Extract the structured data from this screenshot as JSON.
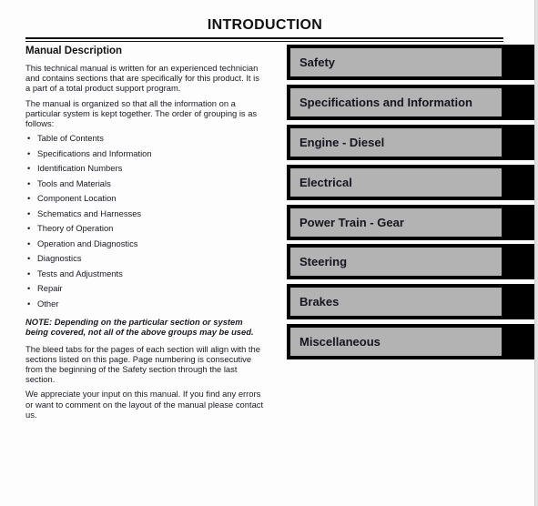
{
  "page": {
    "title": "INTRODUCTION"
  },
  "manual_description": {
    "heading": "Manual Description",
    "intro": "This technical manual is written for an experienced technician and contains sections that are specifically for this product. It is a part of a total product support program.",
    "organization": "The manual is organized so that all the information on a particular system is kept together. The order of grouping is as follows:",
    "groups": [
      "Table of Contents",
      "Specifications and Information",
      "Identification Numbers",
      "Tools and Materials",
      "Component Location",
      "Schematics and Harnesses",
      "Theory of Operation",
      "Operation and Diagnostics",
      "Diagnostics",
      "Tests and Adjustments",
      "Repair",
      "Other"
    ],
    "bullet_glyph": "•",
    "note": "NOTE: Depending on the particular section or system being covered, not all of the above groups may be used.",
    "bleed_tabs": "The bleed tabs for the pages of each section will align with the sections listed on this page. Page numbering is consecutive from the beginning of the Safety section through the last section.",
    "feedback": "We appreciate your input on this manual. If you find any errors or want to comment on the layout of the manual please contact us."
  },
  "section_tabs": [
    {
      "label": "Safety"
    },
    {
      "label": "Specifications and Information"
    },
    {
      "label": "Engine - Diesel"
    },
    {
      "label": "Electrical"
    },
    {
      "label": "Power Train - Gear"
    },
    {
      "label": "Steering"
    },
    {
      "label": "Brakes"
    },
    {
      "label": "Miscellaneous"
    }
  ],
  "colors": {
    "tab_outer": "#000000",
    "tab_panel": "#b3b3b3",
    "text": "#1a1a22"
  }
}
